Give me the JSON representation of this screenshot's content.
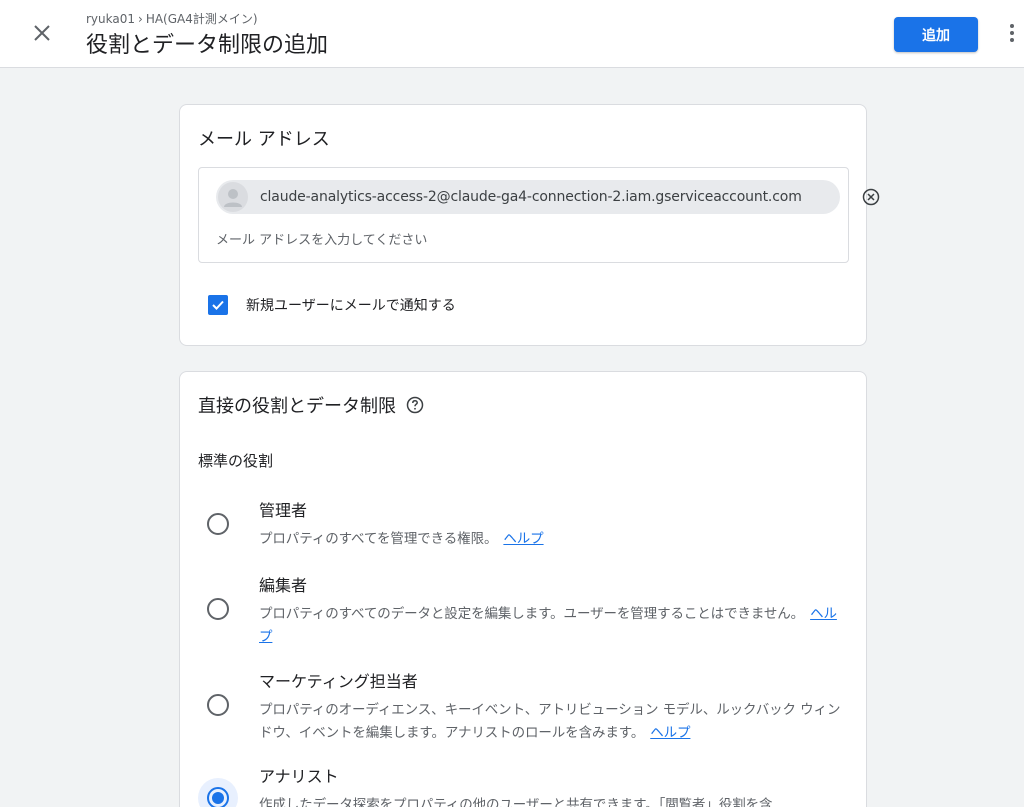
{
  "header": {
    "breadcrumb_account": "ryuka01",
    "breadcrumb_sep": "›",
    "breadcrumb_property": "HA(GA4計測メイン)",
    "title": "役割とデータ制限の追加",
    "add_label": "追加",
    "primary_color": "#1a73e8"
  },
  "email_section": {
    "title": "メール アドレス",
    "chip_email": "claude-analytics-access-2@claude-ga4-connection-2.iam.gserviceaccount.com",
    "input_placeholder": "メール アドレスを入力してください",
    "input_value": "",
    "notify_label": "新規ユーザーにメールで通知する",
    "notify_checked": true
  },
  "roles_section": {
    "title": "直接の役割とデータ制限",
    "standard_roles_label": "標準の役割",
    "help_link_label": "ヘルプ",
    "roles": [
      {
        "name": "管理者",
        "desc": "プロパティのすべてを管理できる権限。",
        "selected": false
      },
      {
        "name": "編集者",
        "desc": "プロパティのすべてのデータと設定を編集します。ユーザーを管理することはできません。",
        "selected": false
      },
      {
        "name": "マーケティング担当者",
        "desc": "プロパティのオーディエンス、キーイベント、アトリビューション モデル、ルックバック ウィンドウ、イベントを編集します。アナリストのロールを含みます。",
        "selected": false
      },
      {
        "name": "アナリスト",
        "desc": "作成したデータ探索をプロパティの他のユーザーと共有できます。「閲覧者」役割を含",
        "selected": true
      }
    ]
  },
  "icons": {
    "close": "close-icon",
    "more": "more-vert-icon",
    "avatar": "person-avatar-icon",
    "remove": "cancel-circle-icon",
    "check": "check-icon",
    "help": "help-circle-icon"
  }
}
